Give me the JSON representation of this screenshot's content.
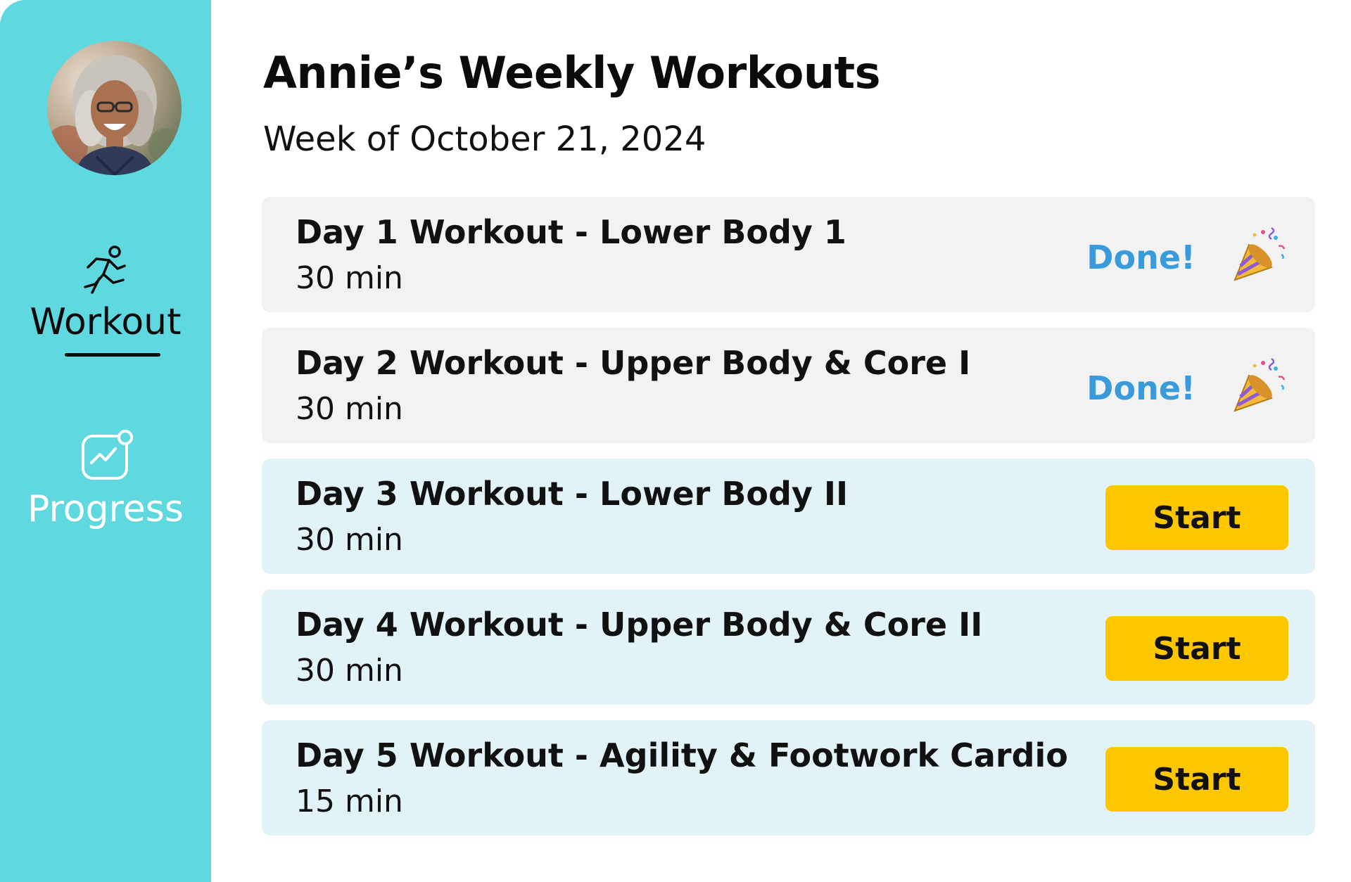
{
  "header": {
    "title": "Annie’s Weekly Workouts",
    "subtitle": "Week of October 21, 2024"
  },
  "sidebar": {
    "avatar_icon": "user-photo",
    "items": [
      {
        "label": "Workout",
        "icon": "running-person-icon",
        "active": true
      },
      {
        "label": "Progress",
        "icon": "progress-chart-icon",
        "active": false
      }
    ]
  },
  "workouts": [
    {
      "name": "Day 1 Workout - Lower Body 1",
      "duration": "30 min",
      "status_label": "Done!",
      "status_icon": "party-popper-icon"
    },
    {
      "name": "Day 2 Workout - Upper Body & Core I",
      "duration": "30 min",
      "status_label": "Done!",
      "status_icon": "party-popper-icon"
    },
    {
      "name": "Day 3 Workout - Lower Body II",
      "duration": "30 min",
      "action_label": "Start"
    },
    {
      "name": "Day 4 Workout - Upper Body & Core II",
      "duration": "30 min",
      "action_label": "Start"
    },
    {
      "name": "Day 5 Workout - Agility & Footwork Cardio",
      "duration": "15 min",
      "action_label": "Start"
    }
  ],
  "colors": {
    "sidebar": "#5fd8df",
    "done_card": "#f2f2f2",
    "todo_card": "#e2f3f8",
    "done_text": "#3a9bdc",
    "start_button": "#fdc700"
  }
}
